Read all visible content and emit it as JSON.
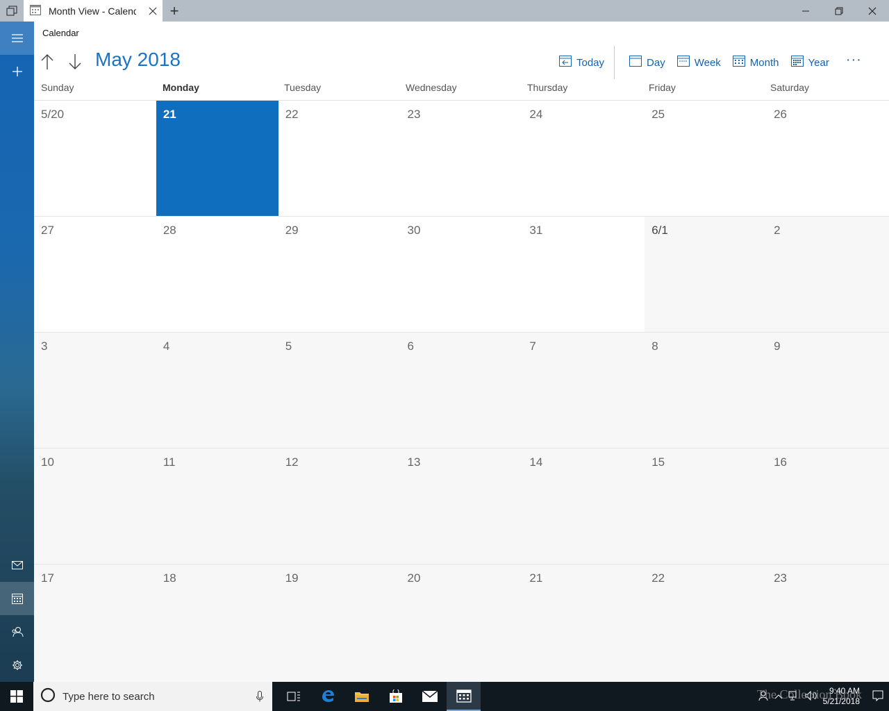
{
  "window": {
    "tab_title": "Month View - Calendar",
    "new_tab": "+"
  },
  "app": {
    "name": "Calendar",
    "month_title": "May 2018"
  },
  "toolbar": {
    "today": "Today",
    "day": "Day",
    "week": "Week",
    "month": "Month",
    "year": "Year",
    "more": "···"
  },
  "weekdays": [
    "Sunday",
    "Monday",
    "Tuesday",
    "Wednesday",
    "Thursday",
    "Friday",
    "Saturday"
  ],
  "weeks": [
    [
      "5/20",
      "21",
      "22",
      "23",
      "24",
      "25",
      "26"
    ],
    [
      "27",
      "28",
      "29",
      "30",
      "31",
      "6/1",
      "2"
    ],
    [
      "3",
      "4",
      "5",
      "6",
      "7",
      "8",
      "9"
    ],
    [
      "10",
      "11",
      "12",
      "13",
      "14",
      "15",
      "16"
    ],
    [
      "17",
      "18",
      "19",
      "20",
      "21",
      "22",
      "23"
    ]
  ],
  "taskbar": {
    "search_placeholder": "Type here to search",
    "time": "9:40 AM",
    "date": "5/21/2018"
  },
  "watermark": "The Collection Book",
  "colors": {
    "accent": "#106ebe",
    "accent_text": "#1a73c6"
  }
}
